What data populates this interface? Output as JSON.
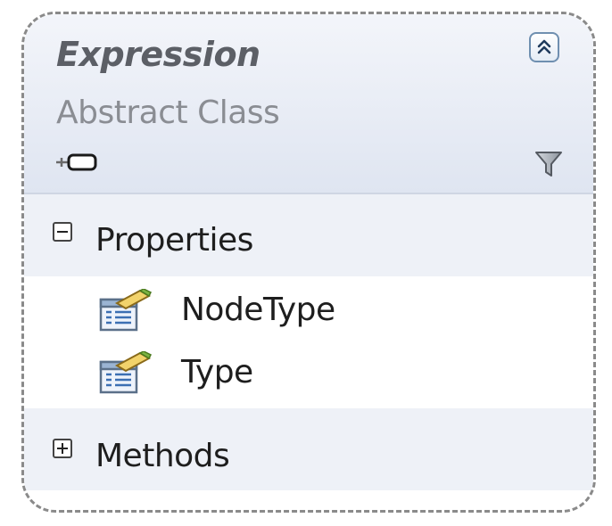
{
  "class": {
    "name": "Expression",
    "kind": "Abstract Class"
  },
  "compartments": {
    "properties": {
      "label": "Properties",
      "expanded": true,
      "members": [
        {
          "name": "NodeType",
          "icon": "property-icon"
        },
        {
          "name": "Type",
          "icon": "property-icon"
        }
      ]
    },
    "methods": {
      "label": "Methods",
      "expanded": false
    }
  },
  "colors": {
    "header_gradient_top": "#f3f5fa",
    "header_gradient_bottom": "#dfe5f1",
    "compartment_header": "#eef1f7",
    "border": "#8a8a8a"
  }
}
